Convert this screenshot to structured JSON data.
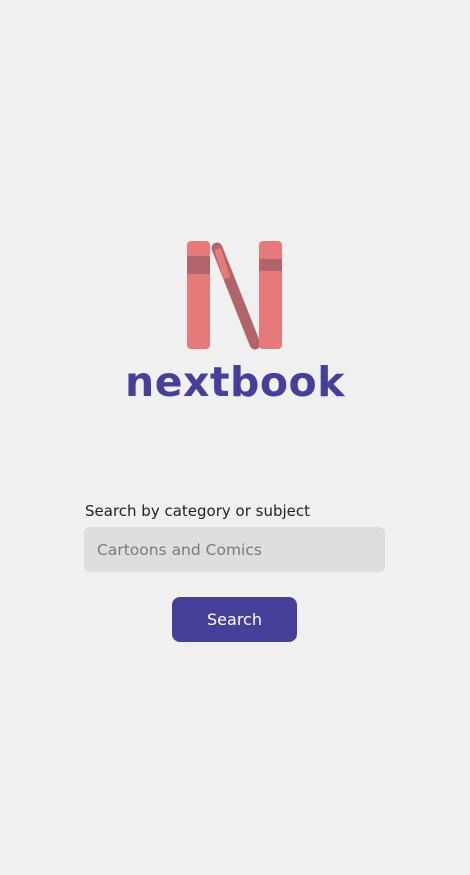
{
  "brand": {
    "name": "nextbook",
    "logo_icon": "bookshelf-n-icon",
    "book_color": "#e67a78",
    "band_color": "#b1646a",
    "wordmark_color": "#46409a"
  },
  "search": {
    "label": "Search by category or subject",
    "placeholder": "Cartoons and Comics",
    "value": "",
    "button_label": "Search",
    "button_color": "#46409a",
    "input_background": "#dddddd"
  },
  "page": {
    "background": "#f0f0f0"
  }
}
